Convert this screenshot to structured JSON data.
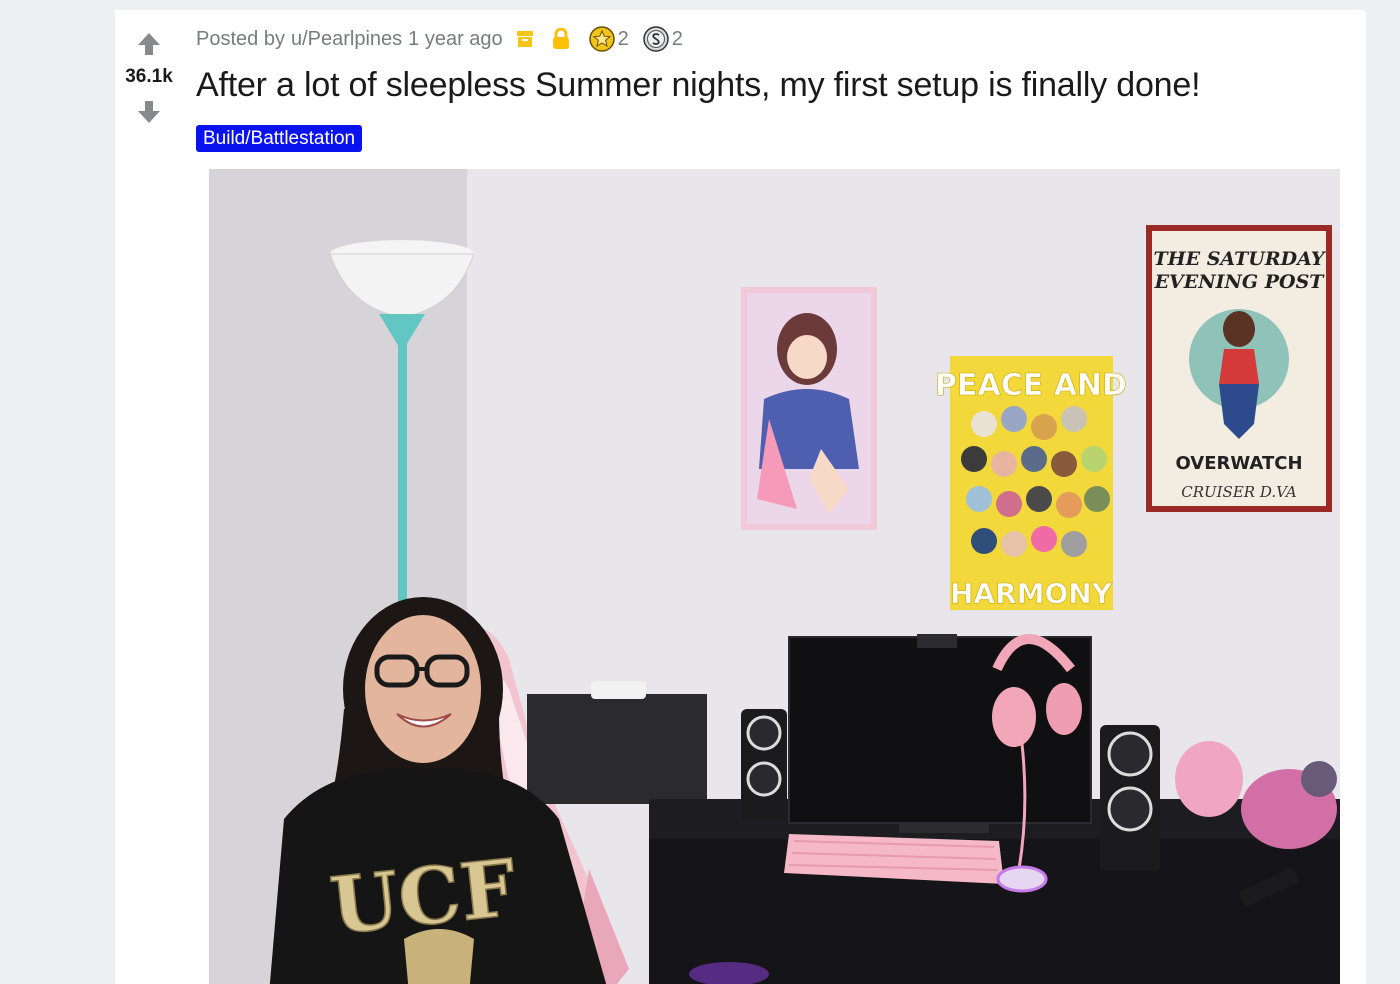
{
  "post": {
    "score": "36.1k",
    "meta": {
      "posted_by_label": "Posted by",
      "author": "u/Pearlpines",
      "time": "1 year ago",
      "award_1_count": "2",
      "award_2_count": "2"
    },
    "title": "After a lot of sleepless Summer nights, my first setup is finally done!",
    "flair": "Build/Battlestation",
    "image": {
      "poster_middle_text_top": "PEACE AND",
      "poster_middle_text_bottom": "HARMONY",
      "poster_right_title_1": "THE SATURDAY",
      "poster_right_title_2": "EVENING POST",
      "poster_right_brand": "OVERWATCH",
      "poster_right_sub": "CRUISER D.VA",
      "hoodie_text": "UCF"
    }
  },
  "icons": {
    "upvote": "arrow-up-icon",
    "downvote": "arrow-down-icon",
    "archived": "archive-box-icon",
    "locked": "lock-icon",
    "award_1": "gold-star-award-icon",
    "award_2": "silver-coin-award-icon"
  },
  "colors": {
    "flair_bg": "#0a12f0",
    "meta_text": "#787c7e",
    "title_text": "#1a1a1b",
    "vote_arrow": "#878a8c",
    "archive_icon": "#f5c518",
    "lock_icon": "#ffc107"
  }
}
